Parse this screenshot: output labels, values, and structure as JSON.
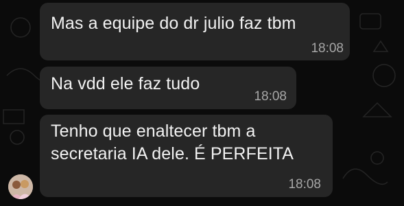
{
  "messages": [
    {
      "text": "Mas a equipe do dr julio faz tbm",
      "time": "18:08"
    },
    {
      "text": "Na vdd ele faz tudo",
      "time": "18:08"
    },
    {
      "text": "Tenho que enaltecer tbm a\nsecretaria IA dele. É PERFEITA",
      "time": "18:08"
    }
  ],
  "colors": {
    "background": "#0b0b0b",
    "bubble": "#262626",
    "text": "#f2f2f2",
    "timestamp": "#a7a7a7"
  },
  "icons": [
    "sender-avatar"
  ]
}
